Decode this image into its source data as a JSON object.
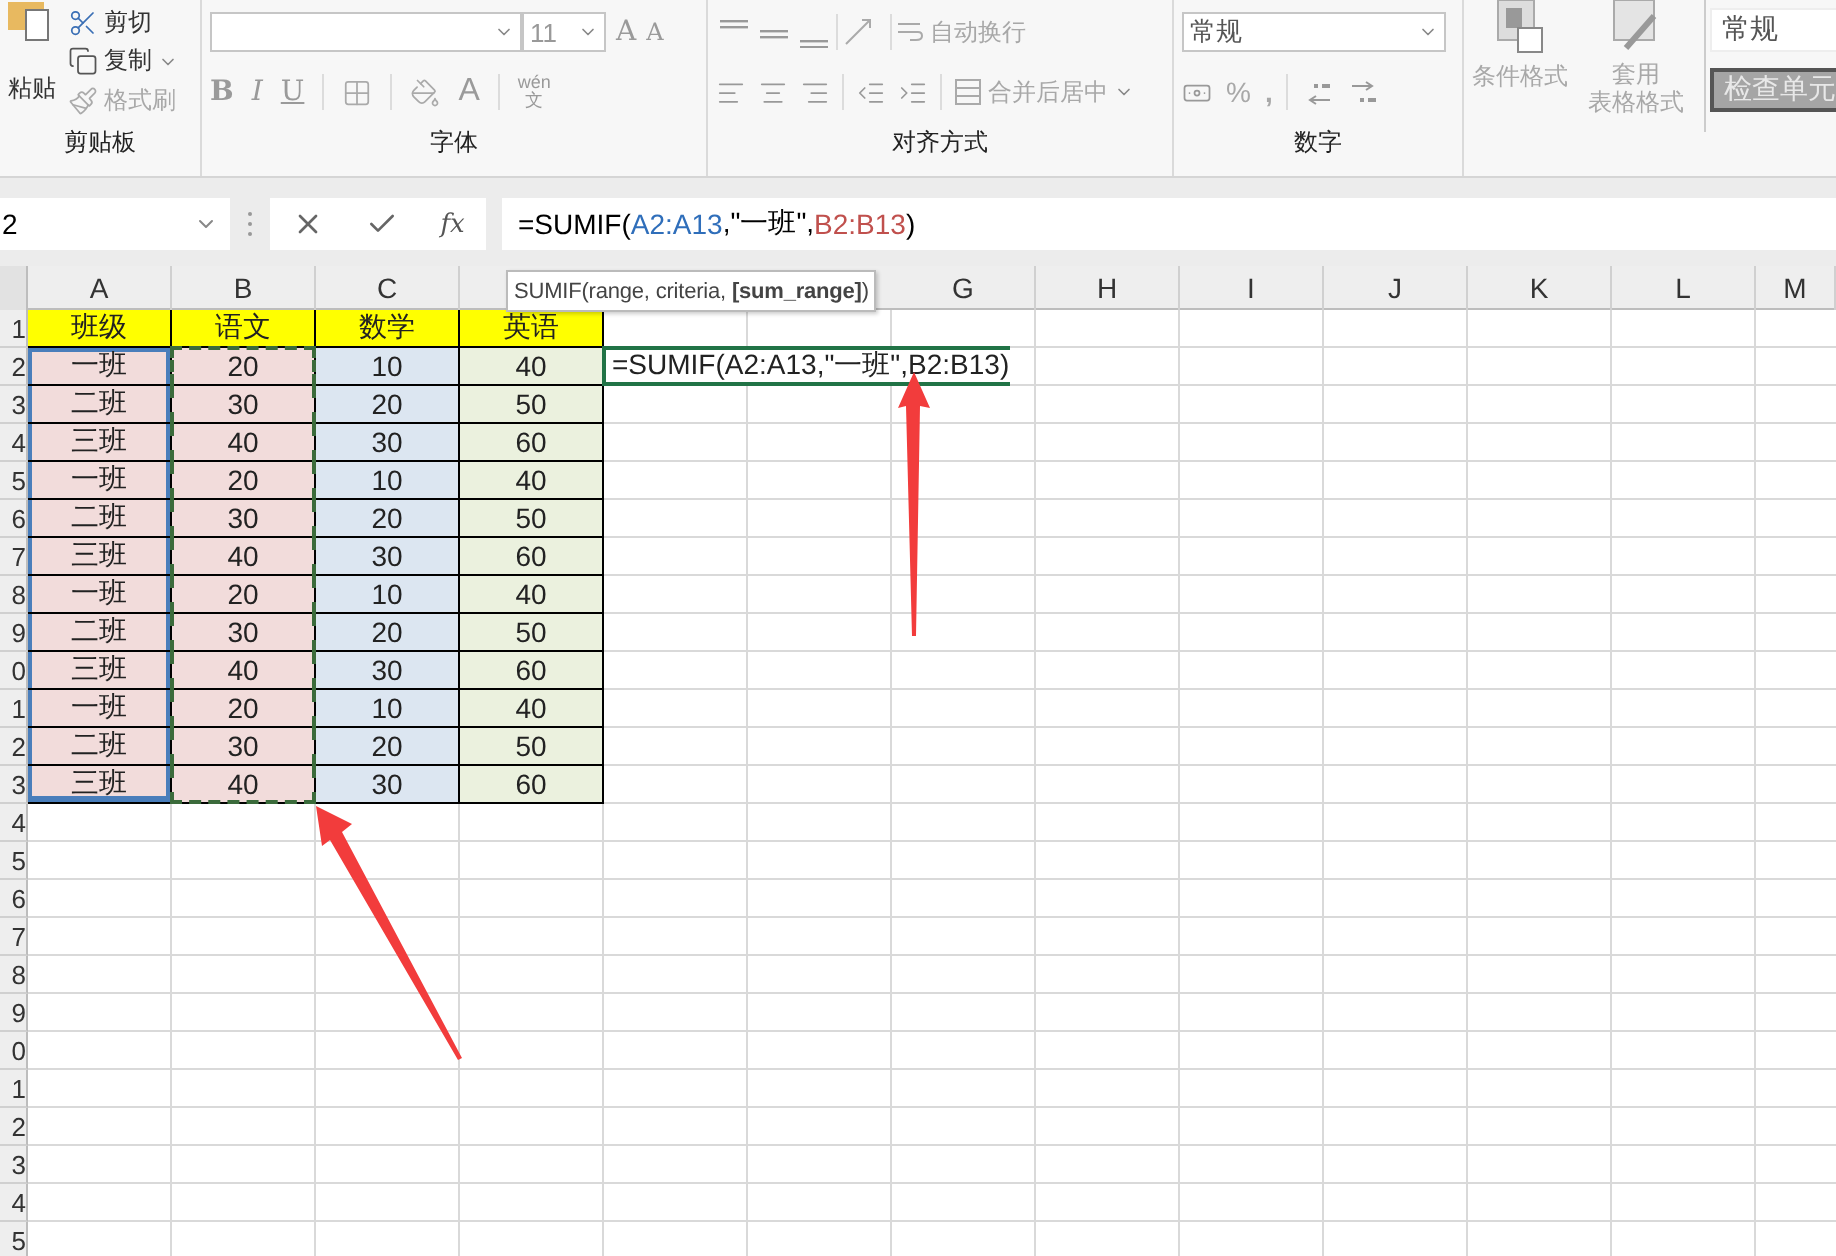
{
  "ribbon": {
    "clipboard": {
      "paste": "粘贴",
      "cut": "剪切",
      "copy": "复制",
      "format_painter": "格式刷",
      "label": "剪贴板"
    },
    "font": {
      "size": "11",
      "grow": "A",
      "shrink": "A",
      "bold": "B",
      "italic": "I",
      "underline": "U",
      "font_color": "A",
      "phonetic": [
        "wén",
        "文"
      ],
      "label": "字体"
    },
    "alignment": {
      "wrap": "自动换行",
      "merge": "合并后居中",
      "label": "对齐方式"
    },
    "number": {
      "format": "常规",
      "percent": "%",
      "comma": ",",
      "label": "数字"
    },
    "styles": {
      "conditional": "条件格式",
      "table_format": [
        "套用",
        "表格格式"
      ],
      "normal": "常规",
      "check": "检查单元"
    }
  },
  "formula_bar": {
    "name_box": "2",
    "fx": "fx",
    "formula": [
      {
        "text": "=SUMIF(",
        "color": "#000000"
      },
      {
        "text": "A2:A13",
        "color": "#2f6eba"
      },
      {
        "text": ",\"一班\",",
        "color": "#000000"
      },
      {
        "text": "B2:B13",
        "color": "#c0504d"
      },
      {
        "text": ")",
        "color": "#000000"
      }
    ]
  },
  "tooltip": "SUMIF(range, criteria, **[sum_range]**)",
  "sheet": {
    "column_letters": [
      "A",
      "B",
      "C",
      "G",
      "H",
      "I",
      "J",
      "K",
      "L",
      "M"
    ],
    "row_numbers": [
      "1",
      "2",
      "3",
      "4",
      "5",
      "6",
      "7",
      "8",
      "9",
      "0",
      "1",
      "2",
      "3",
      "4",
      "5",
      "6",
      "7",
      "8",
      "9",
      "0",
      "1",
      "2",
      "3",
      "4",
      "5"
    ],
    "columns": [
      {
        "header": "班级",
        "color": "#f2dcdb",
        "referenced": true,
        "copy_marked": false
      },
      {
        "header": "语文",
        "color": "#f2dcdb",
        "referenced": false,
        "copy_marked": true
      },
      {
        "header": "数学",
        "color": "#dce6f1",
        "referenced": false,
        "copy_marked": false
      },
      {
        "header": "英语",
        "color": "#ebf1de",
        "referenced": false,
        "copy_marked": false
      }
    ],
    "rows": [
      [
        "一班",
        "20",
        "10",
        "40"
      ],
      [
        "二班",
        "30",
        "20",
        "50"
      ],
      [
        "三班",
        "40",
        "30",
        "60"
      ],
      [
        "一班",
        "20",
        "10",
        "40"
      ],
      [
        "二班",
        "30",
        "20",
        "50"
      ],
      [
        "三班",
        "40",
        "30",
        "60"
      ],
      [
        "一班",
        "20",
        "10",
        "40"
      ],
      [
        "二班",
        "30",
        "20",
        "50"
      ],
      [
        "三班",
        "40",
        "30",
        "60"
      ],
      [
        "一班",
        "20",
        "10",
        "40"
      ],
      [
        "二班",
        "30",
        "20",
        "50"
      ],
      [
        "三班",
        "40",
        "30",
        "60"
      ]
    ],
    "editing_text": "=SUMIF(A2:A13,\"一班\",B2:B13)"
  }
}
